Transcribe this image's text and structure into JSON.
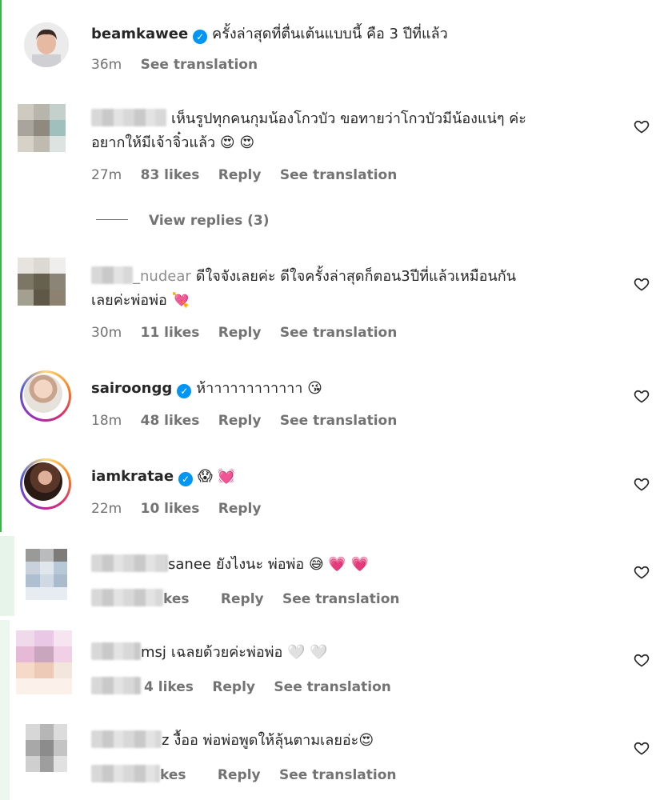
{
  "comments": [
    {
      "username": "beamkawee",
      "verified": true,
      "text": "ครั้งล่าสุดที่ตื่นเต้นแบบนี้ คือ 3 ปีที่แล้ว",
      "time": "36m",
      "see_translation": "See translation"
    },
    {
      "username": "",
      "text_line1": "เห็นรูปทุกคนกุมน้องโกวบัว ขอทายว่าโกวบัวมีน้องแน่ๆ ค่ะ",
      "text_line2": "อยากให้มีเจ้าจิ๋วแล้ว",
      "emoji": "😍 😍",
      "time": "27m",
      "likes": "83 likes",
      "reply": "Reply",
      "see_translation": "See translation",
      "view_replies": "View replies (3)"
    },
    {
      "username_partial": "_nudear",
      "text_line1": "ดีใจจังเลยค่ะ ดีใจครั้งล่าสุดก็ตอน3ปีที่แล้วเหมือนกัน",
      "text_line2": "เลยค่ะพ่อพ่อ",
      "emoji": "💘",
      "time": "30m",
      "likes": "11 likes",
      "reply": "Reply",
      "see_translation": "See translation"
    },
    {
      "username": "sairoongg",
      "verified": true,
      "text": "ห้าาาาาาาาาาาา",
      "emoji": "😘",
      "time": "18m",
      "likes": "48 likes",
      "reply": "Reply",
      "see_translation": "See translation"
    },
    {
      "username": "iamkratae",
      "verified": true,
      "emoji": "😱 💓",
      "time": "22m",
      "likes": "10 likes",
      "reply": "Reply"
    },
    {
      "username_partial": "sanee",
      "text": "ยังไงนะ พ่อพ่อ",
      "emoji": "😅 💗 💗",
      "likes_partial": "kes",
      "reply": "Reply",
      "see_translation": "See translation"
    },
    {
      "username_partial": "msj",
      "text": "เฉลยด้วยค่ะพ่อพ่อ",
      "emoji": "🤍 🤍",
      "likes": "4 likes",
      "reply": "Reply",
      "see_translation": "See translation"
    },
    {
      "username_partial": "z",
      "text": "งื้ออ พ่อพ่อพูดให้ลุ้นตามเลยอ่ะ",
      "emoji": "😍",
      "likes_partial": "kes",
      "reply": "Reply",
      "see_translation": "See translation"
    }
  ],
  "icons": {
    "verified": "verified-badge-icon",
    "like": "heart-outline-icon"
  },
  "colors": {
    "verified": "#0095f6",
    "meta_text": "#737373",
    "accent_bar": "#3bb54a"
  }
}
